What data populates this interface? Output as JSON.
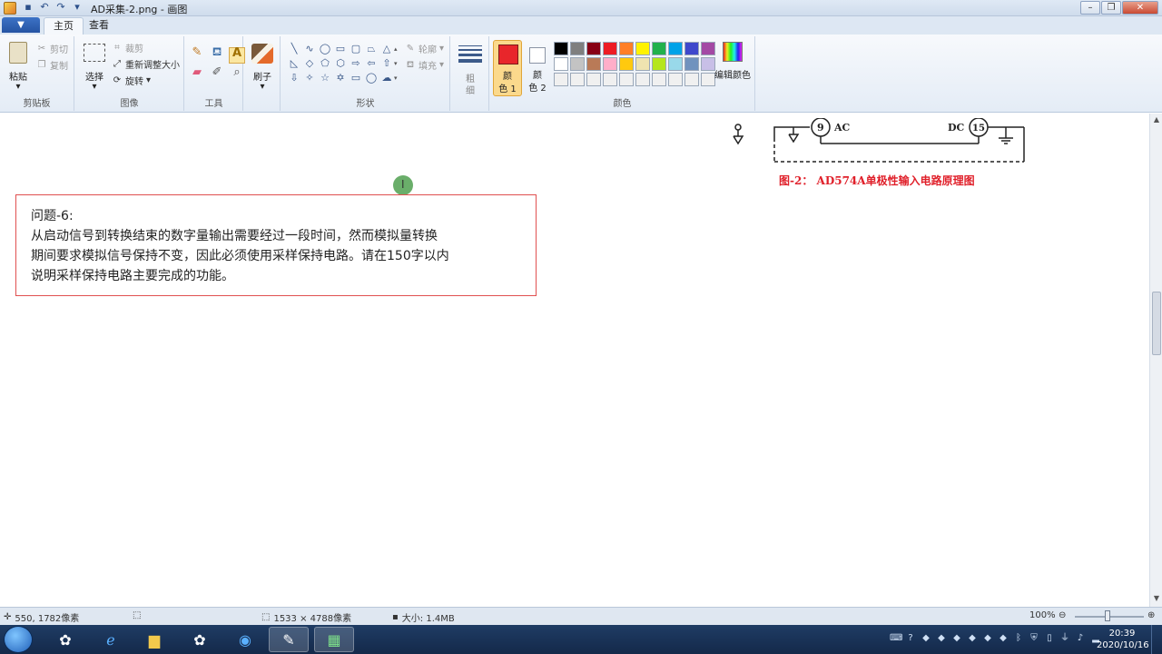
{
  "window": {
    "title": "AD采集-2.png - 画图"
  },
  "tabs": {
    "file_menu": "▼",
    "home": "主页",
    "view": "查看"
  },
  "clipboard": {
    "paste": "粘贴",
    "cut": "剪切",
    "copy": "复制",
    "label": "剪贴板"
  },
  "image": {
    "select": "选择",
    "crop": "裁剪",
    "resize": "重新调整大小",
    "rotate": "旋转",
    "label": "图像"
  },
  "tools": {
    "label": "工具"
  },
  "brushes": {
    "label": "刷子"
  },
  "shapes": {
    "outline": "轮廓",
    "fill": "填充",
    "label": "形状"
  },
  "size": {
    "label_top": "粗",
    "label_bottom": "细"
  },
  "colors": {
    "color1_top": "颜",
    "color1_bottom": "色 1",
    "color2_top": "颜",
    "color2_bottom": "色 2",
    "edit": "编辑颜色",
    "label": "颜色",
    "color1_value": "#e8262b",
    "color2_value": "#ffffff",
    "palette": [
      "#000000",
      "#7f7f7f",
      "#880015",
      "#ed1c24",
      "#ff7f27",
      "#fff200",
      "#22b14c",
      "#00a2e8",
      "#3f48cc",
      "#a349a4",
      "#ffffff",
      "#c3c3c3",
      "#b97a57",
      "#ffaec9",
      "#ffc90e",
      "#efe4b0",
      "#b5e61d",
      "#99d9ea",
      "#7092be",
      "#c8bfe7",
      "#f0f0f0",
      "#f0f0f0",
      "#f0f0f0",
      "#f0f0f0",
      "#f0f0f0",
      "#f0f0f0",
      "#f0f0f0",
      "#f0f0f0",
      "#f0f0f0",
      "#f0f0f0"
    ]
  },
  "canvas": {
    "circuit_labels": {
      "pin9": "9",
      "ac": "AC",
      "dc": "DC",
      "pin15": "15"
    },
    "figure_caption": "图-2： AD574A单极性输入电路原理图",
    "question": {
      "title": "问题-6:",
      "line1": "从启动信号到转换结束的数字量输出需要经过一段时间，然而模拟量转换",
      "line2": "期间要求模拟信号保持不变，因此必须使用采样保持电路。请在150字以内",
      "line3": "说明采样保持电路主要完成的功能。"
    }
  },
  "status": {
    "cursor_pos": "550, 1782像素",
    "dimensions": "1533 × 4788像素",
    "file_size": "大小: 1.4MB",
    "zoom": "100%"
  },
  "taskbar": {
    "time": "20:39",
    "date": "2020/10/16"
  }
}
